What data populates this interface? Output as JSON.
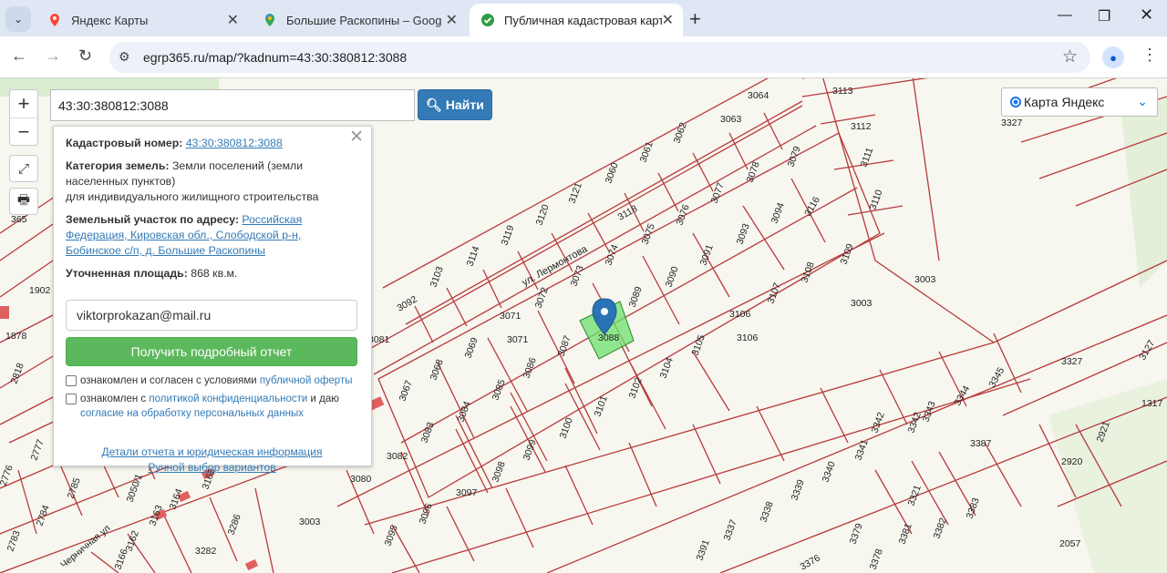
{
  "browser": {
    "tabs": [
      {
        "title": "Яндекс Карты",
        "icon": "yandex-maps-pin-icon",
        "active": false
      },
      {
        "title": "Большие Раскопины – Google",
        "icon": "google-maps-pin-icon",
        "active": false
      },
      {
        "title": "Публичная кадастровая карта",
        "icon": "green-check-icon",
        "active": true
      }
    ],
    "new_tab_label": "+",
    "url": "egrp365.ru/map/?kadnum=43:30:380812:3088",
    "accent": "#dfe7f5"
  },
  "map": {
    "search_value": "43:30:380812:3088",
    "find_label": "Найти",
    "layer_label": "Карта Яндекс",
    "zoom_in": "+",
    "zoom_out": "−",
    "street_label": "ул. Лермонтова",
    "street_label_2": "Черничная ул",
    "parcel_labels": [
      "3064",
      "3113",
      "3063",
      "3112",
      "3327",
      "3062",
      "3061",
      "3111",
      "3060",
      "3079",
      "3078",
      "3110",
      "3121",
      "3077",
      "3116",
      "3118",
      "3120",
      "3076",
      "3094",
      "3119",
      "3075",
      "3093",
      "3114",
      "3074",
      "3109",
      "3103",
      "3073",
      "3091",
      "3108",
      "3072",
      "3089",
      "3090",
      "3107",
      "3092",
      "3071",
      "3106",
      "3003",
      "3081",
      "3071",
      "3088",
      "3106",
      "3105",
      "3069",
      "3087",
      "3003",
      "3068",
      "3086",
      "3104",
      "3327",
      "3345",
      "3067",
      "3085",
      "3102",
      "3101",
      "3344",
      "1317",
      "3084",
      "3100",
      "3343",
      "3342",
      "3342",
      "2921",
      "3083",
      "3099",
      "3387",
      "3082",
      "3341",
      "2920",
      "3098",
      "3340",
      "3080",
      "3097",
      "3321",
      "3339",
      "3338",
      "3096",
      "3383",
      "3095",
      "3337",
      "3382",
      "3379",
      "3381",
      "3391",
      "3376",
      "3378",
      "2057",
      "3003",
      "3282",
      "3286",
      "3165",
      "3164",
      "3163",
      "3162",
      "3166",
      "3050/1",
      "2785",
      "2784",
      "2783",
      "2776",
      "2777",
      "2818",
      "1878",
      "1902",
      "365",
      "3127"
    ]
  },
  "popup": {
    "kad_label": "Кадастровый номер:",
    "kad_value": "43:30:380812:3088",
    "category_label": "Категория земель:",
    "category_value": "Земли поселений (земли населенных пунктов)",
    "category_use": "для индивидуального жилищного строительства",
    "address_label": "Земельный участок по адресу:",
    "address_value": "Российская Федерация, Кировская обл., Слободской р-н, Бобинское с/п, д. Большие Раскопины",
    "area_label": "Уточненная площадь:",
    "area_value": "868 кв.м.",
    "email_value": "viktorprokazan@mail.ru",
    "report_button": "Получить подробный отчет",
    "consent1_text": "ознакомлен и согласен с условиями",
    "consent1_link": "публичной оферты",
    "consent2_text": "ознакомлен с",
    "consent2_link": "политикой конфиденциальности",
    "consent2_text2": "и даю",
    "consent2_link2": "согласие на обработку персональных данных",
    "details_link": "Детали отчета и юридическая информация",
    "manual_link": "Ручной выбор вариантов"
  }
}
